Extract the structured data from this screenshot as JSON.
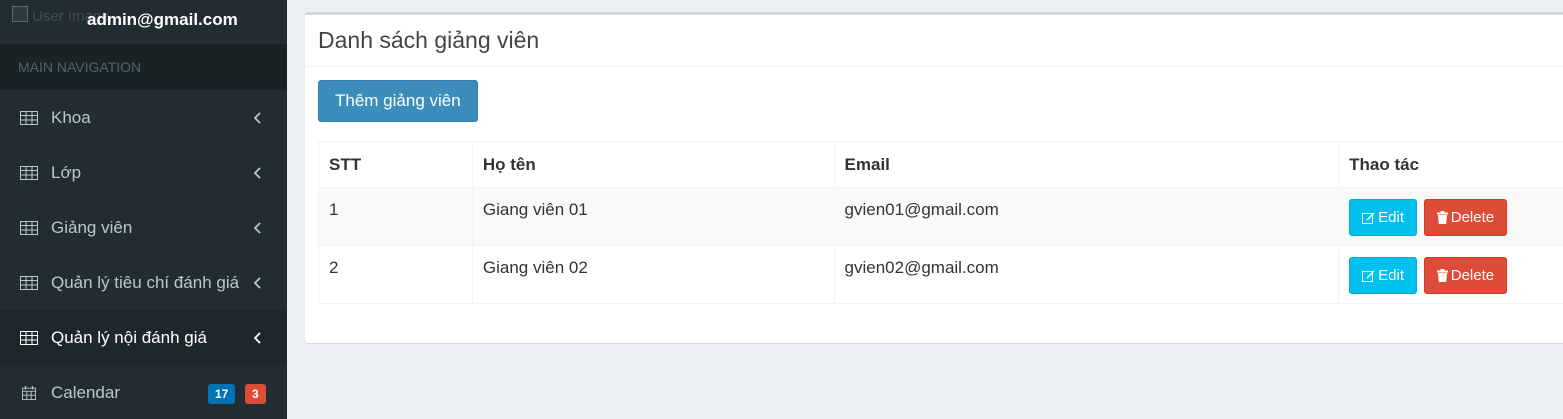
{
  "user": {
    "image_alt": "User Image",
    "email": "admin@gmail.com"
  },
  "sidebar": {
    "header": "MAIN NAVIGATION",
    "items": [
      {
        "label": "Khoa",
        "icon": "table-icon"
      },
      {
        "label": "Lớp",
        "icon": "table-icon"
      },
      {
        "label": "Giảng viên",
        "icon": "table-icon"
      },
      {
        "label": "Quản lý tiêu chí đánh giá",
        "icon": "table-icon"
      },
      {
        "label": "Quản lý nội đánh giá",
        "icon": "table-icon",
        "active": true
      },
      {
        "label": "Calendar",
        "icon": "calendar-icon",
        "badges": [
          "17",
          "3"
        ]
      }
    ]
  },
  "main": {
    "title": "Danh sách giảng viên",
    "add_button": "Thêm giảng viên",
    "table": {
      "headers": [
        "STT",
        "Họ tên",
        "Email",
        "Thao tác"
      ],
      "rows": [
        {
          "stt": "1",
          "name": "Giang viên 01",
          "email": "gvien01@gmail.com"
        },
        {
          "stt": "2",
          "name": "Giang viên 02",
          "email": "gvien02@gmail.com"
        }
      ],
      "edit_label": "Edit",
      "delete_label": "Delete"
    }
  },
  "colors": {
    "sidebar_bg": "#222d32",
    "primary": "#3c8dbc",
    "info": "#00c0ef",
    "danger": "#dd4b39",
    "badge_blue": "#0073b7"
  }
}
